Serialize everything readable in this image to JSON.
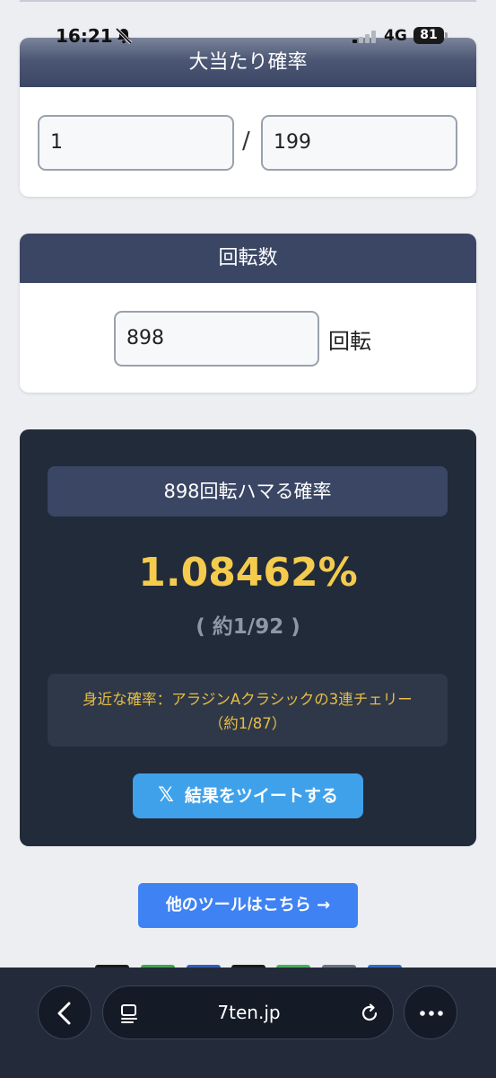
{
  "status_bar": {
    "time": "16:21",
    "network": "4G",
    "battery": "81"
  },
  "card_probability": {
    "title": "大当たり確率",
    "numerator": "1",
    "separator": "/",
    "denominator": "199"
  },
  "card_spins": {
    "title": "回転数",
    "value": "898",
    "unit": "回転"
  },
  "result": {
    "title": "898回転ハマる確率",
    "percent": "1.08462%",
    "approx": "( 約1/92 )",
    "familiar_line1": "身近な確率：アラジンAクラシックの3連チェリー",
    "familiar_line2": "（約1/87）",
    "tweet_label": "結果をツイートする"
  },
  "other_tools_label": "他のツールはこちら →",
  "browser": {
    "url": "7ten.jp"
  },
  "colors": {
    "header": "#3a4664",
    "result_bg": "#222b3a",
    "percent": "#f4cb4c",
    "tweet": "#3fa1ea",
    "tools": "#3f82f3"
  }
}
